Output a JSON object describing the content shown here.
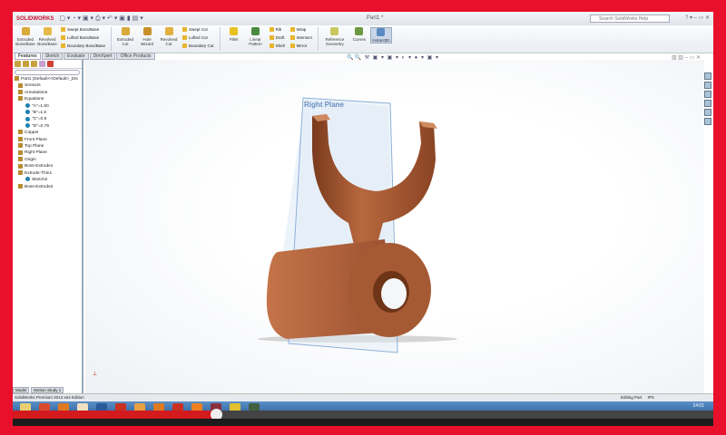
{
  "titlebar": {
    "logo": "SOLIDWORKS",
    "title": "Part1 *",
    "search_placeholder": "Search SolidWorks Help"
  },
  "ribbon": {
    "big1": [
      "Extruded Boss/Base",
      "Revolved Boss/Base"
    ],
    "col1": [
      "Swept Boss/Base",
      "Lofted Boss/Base",
      "Boundary Boss/Base"
    ],
    "big2": [
      "Extruded Cut",
      "Hole Wizard",
      "Revolved Cut"
    ],
    "col2": [
      "Swept Cut",
      "Lofted Cut",
      "Boundary Cut"
    ],
    "big3": [
      "Fillet",
      "Linear Pattern"
    ],
    "col3": [
      "Rib",
      "Draft",
      "Shell"
    ],
    "col4": [
      "Wrap",
      "Intersect",
      "Mirror"
    ],
    "big4": [
      "Reference Geometry",
      "Curves",
      "Instant3D"
    ]
  },
  "tabs": [
    "Features",
    "Sketch",
    "Evaluate",
    "DimXpert",
    "Office Products"
  ],
  "tree": {
    "root": "Part1  (Default<<Default>_Dis",
    "items": [
      {
        "label": "Sensors",
        "level": 1
      },
      {
        "label": "Annotations",
        "level": 1
      },
      {
        "label": "Equations",
        "level": 1
      },
      {
        "label": "\"A\"=1.50",
        "level": 2
      },
      {
        "label": "\"B\"=1.5",
        "level": 2
      },
      {
        "label": "\"C\"=0.5",
        "level": 2
      },
      {
        "label": "\"D\"=0.75",
        "level": 2
      },
      {
        "label": "Copper",
        "level": 1
      },
      {
        "label": "Front Plane",
        "level": 1
      },
      {
        "label": "Top Plane",
        "level": 1
      },
      {
        "label": "Right Plane",
        "level": 1
      },
      {
        "label": "Origin",
        "level": 1
      },
      {
        "label": "Boss-Extrude1",
        "level": 1
      },
      {
        "label": "Extrude-Thin1",
        "level": 1
      },
      {
        "label": "Sketch2",
        "level": 2
      },
      {
        "label": "Boss-Extrude2",
        "level": 1
      }
    ]
  },
  "viewport": {
    "plane_label": "Right Plane",
    "part_color": "#b5633a",
    "plane_color": "#8fb0d8"
  },
  "bottom_tabs": [
    "Model",
    "Motion Study 1"
  ],
  "status": {
    "left": "SolidWorks Premium 2013 x64 Edition",
    "mode": "Editing Part",
    "units": "IPS"
  },
  "taskbar": {
    "clock": "14:01"
  },
  "video": {
    "progress_percent": 29
  }
}
